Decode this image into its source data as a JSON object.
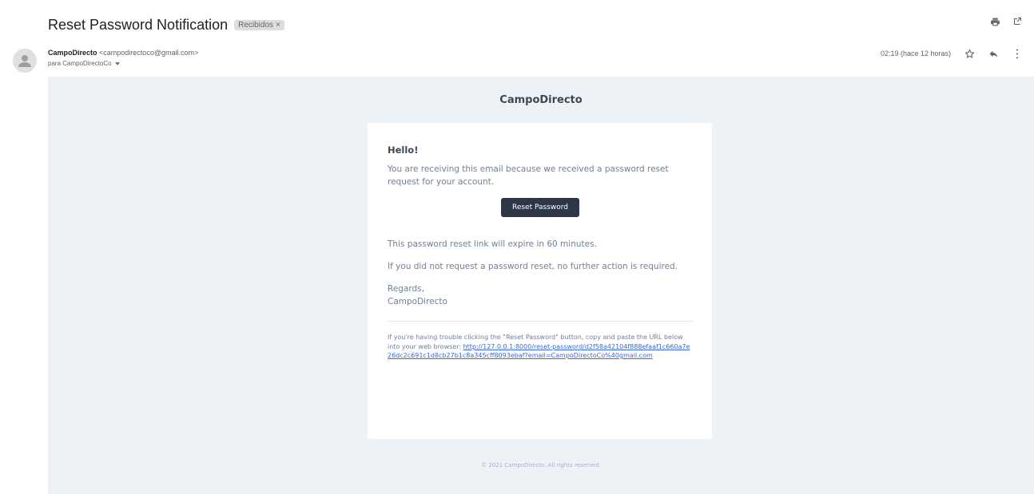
{
  "header": {
    "subject": "Reset Password Notification",
    "label": "Recibidos",
    "label_close": "×",
    "print_icon": "print-icon",
    "open_icon": "open-in-new-window-icon"
  },
  "message": {
    "sender_name": "CampoDirecto",
    "sender_email": "<campodirectoco@gmail.com>",
    "recipient": "para CampoDirectoCo",
    "timestamp": "02:19 (hace 12 horas)",
    "star_icon": "star-icon",
    "reply_icon": "reply-icon",
    "more_icon": "more-vertical-icon"
  },
  "email": {
    "brand": "CampoDirecto",
    "greeting": "Hello!",
    "intro": "You are receiving this email because we received a password reset request for your account.",
    "button_label": "Reset Password",
    "expire_text": "This password reset link will expire in 60 minutes.",
    "no_action_text": "If you did not request a password reset, no further action is required.",
    "regards": "Regards,",
    "signature": "CampoDirecto",
    "subcopy_text": "If you're having trouble clicking the \"Reset Password\" button, copy and paste the URL below into your web browser: ",
    "link": "http://127.0.0.1:8000/reset-password/d2f58a42104f888efaaf1c660a7e26dc2c691c1d8cb27b1c8a345cff8093ebaf?email=CampoDirectoCo%40gmail.com",
    "footer": "© 2021 CampoDirecto. All rights reserved."
  },
  "colors": {
    "body_bg": "#edf2f7",
    "button_bg": "#2d3748",
    "link": "#3869d4"
  }
}
